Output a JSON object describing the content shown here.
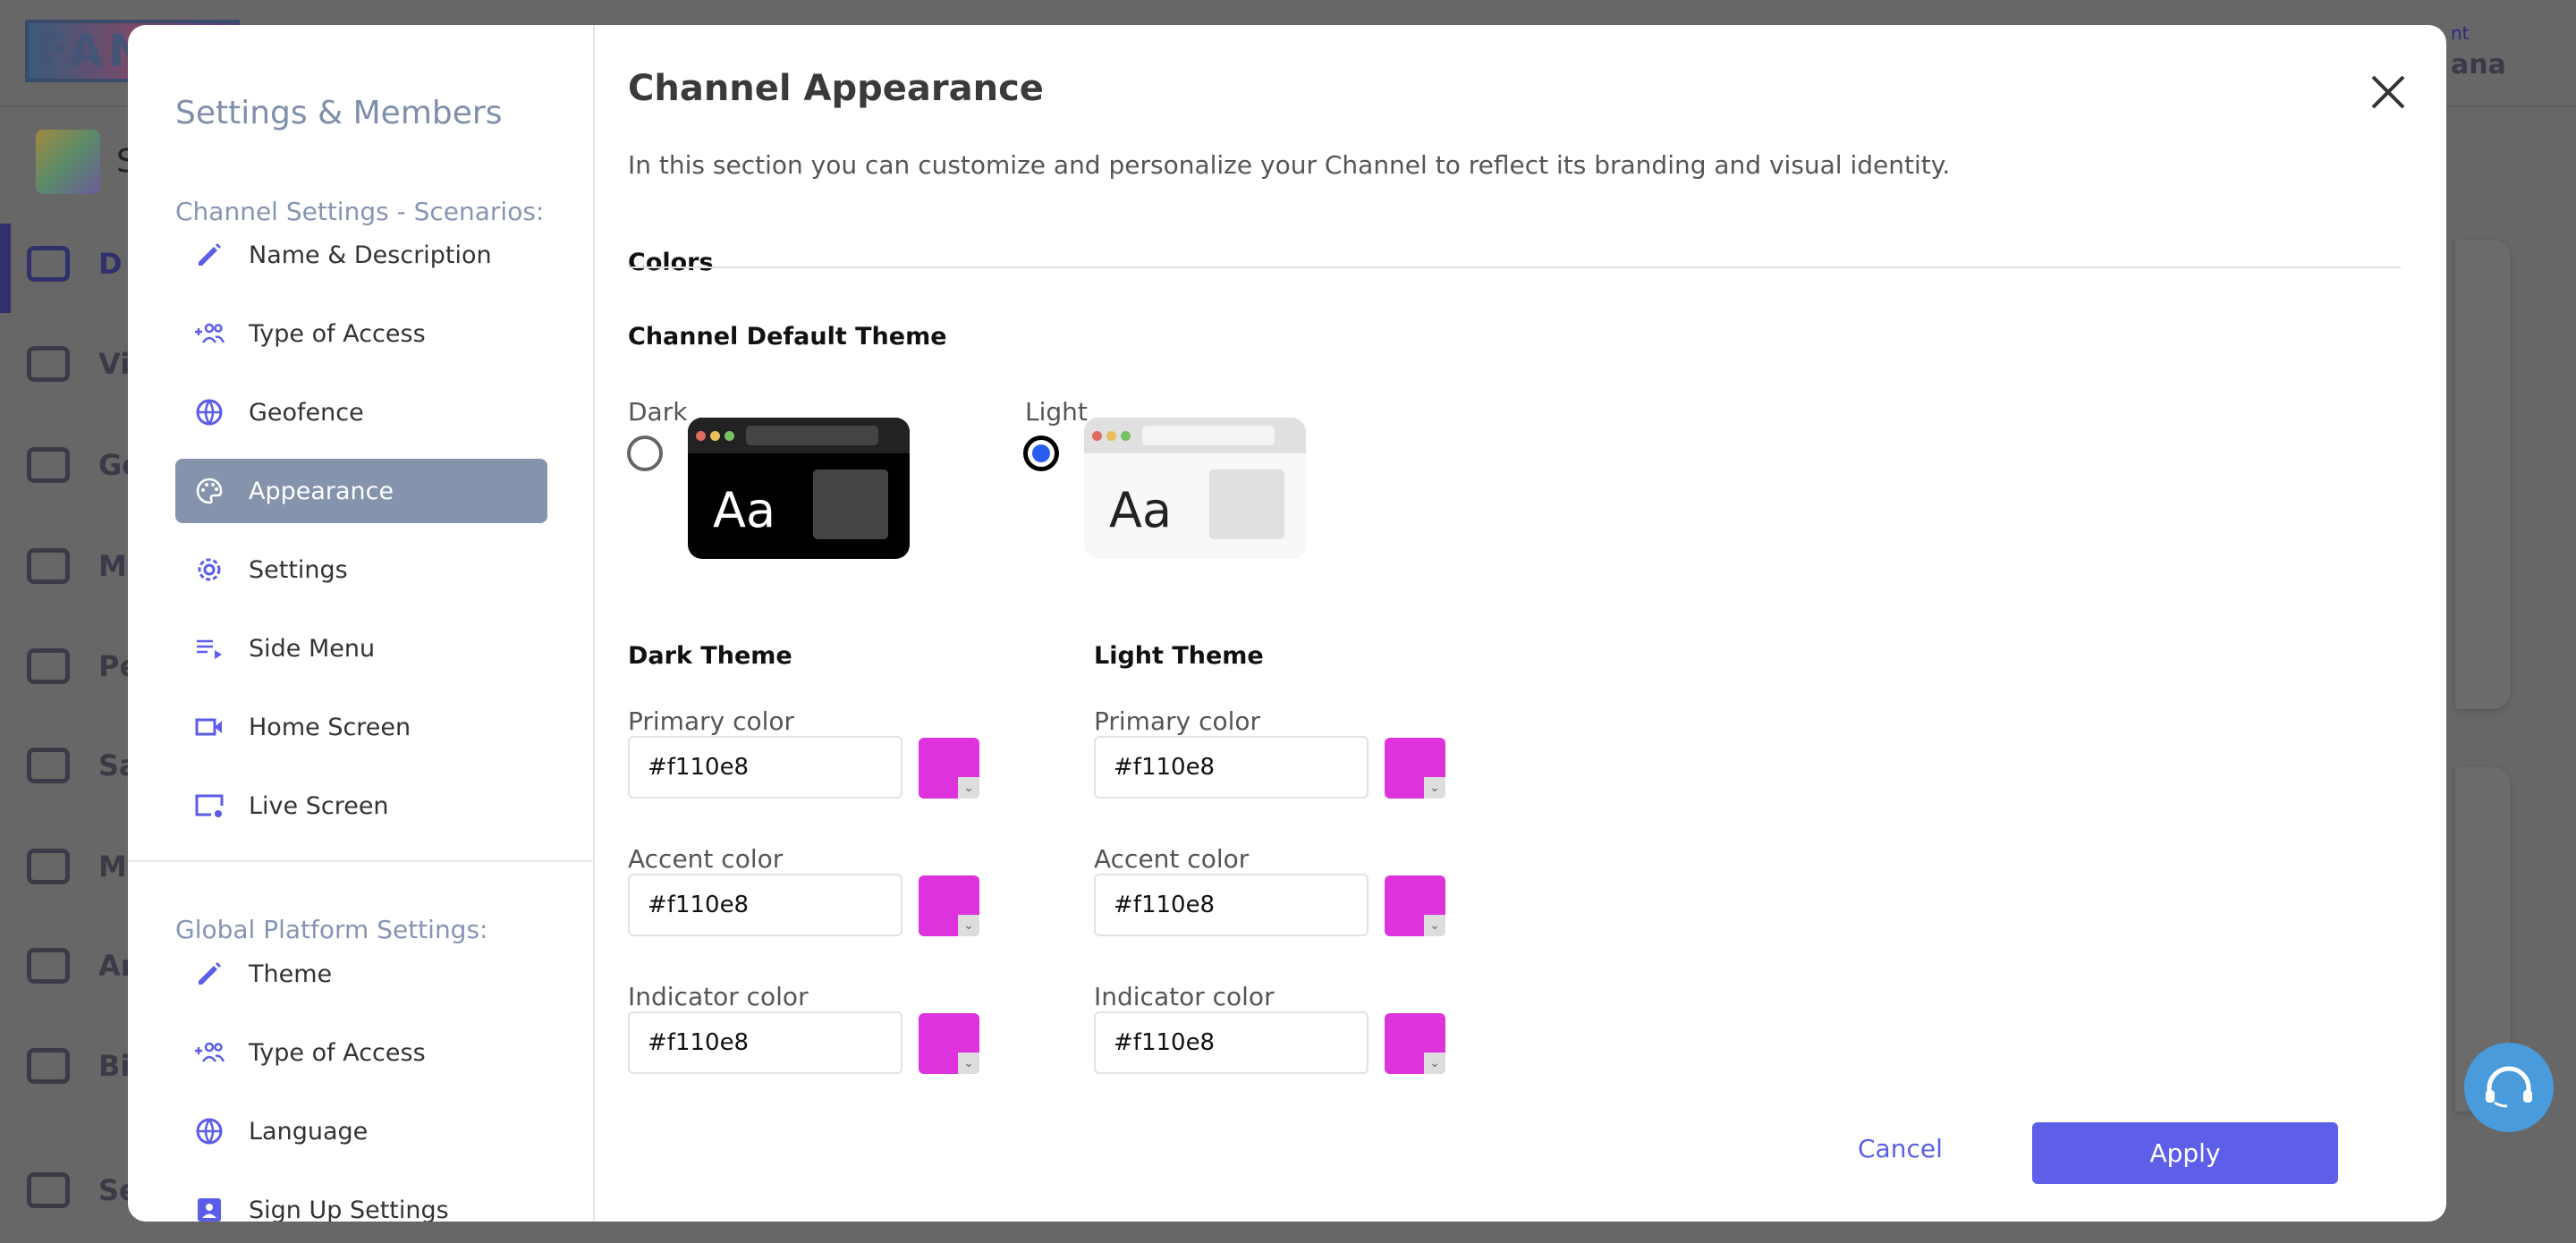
{
  "background": {
    "logo": "FANI",
    "channel_initial": "S",
    "user_line1": "nt",
    "user_line2": "ana",
    "sidebar": [
      "D",
      "Vi",
      "Go",
      "Ma",
      "Pe",
      "Sal",
      "Ma",
      "An",
      "Bil",
      "Se"
    ]
  },
  "sidebar": {
    "title": "Settings & Members",
    "channel_section": "Channel Settings - Scenarios:",
    "channel_items": [
      {
        "label": "Name & Description",
        "icon": "pencil-icon"
      },
      {
        "label": "Type of Access",
        "icon": "add-group-icon"
      },
      {
        "label": "Geofence",
        "icon": "globe-icon"
      },
      {
        "label": "Appearance",
        "icon": "palette-icon",
        "active": true
      },
      {
        "label": "Settings",
        "icon": "gear-icon"
      },
      {
        "label": "Side Menu",
        "icon": "playlist-icon"
      },
      {
        "label": "Home Screen",
        "icon": "video-camera-icon"
      },
      {
        "label": "Live Screen",
        "icon": "screen-settings-icon"
      }
    ],
    "global_section": "Global Platform Settings:",
    "global_items": [
      {
        "label": "Theme",
        "icon": "pencil-icon"
      },
      {
        "label": "Type of Access",
        "icon": "add-group-icon"
      },
      {
        "label": "Language",
        "icon": "globe-icon"
      },
      {
        "label": "Sign Up Settings",
        "icon": "user-card-icon"
      }
    ]
  },
  "main": {
    "title": "Channel Appearance",
    "subtitle": "In this section you can customize and personalize your Channel to reflect its branding and visual identity.",
    "colors_heading": "Colors",
    "default_theme_heading": "Channel Default Theme",
    "themes": [
      {
        "label": "Dark",
        "preview_text": "Aa",
        "selected": false
      },
      {
        "label": "Light",
        "preview_text": "Aa",
        "selected": true
      }
    ],
    "dark_theme": {
      "heading": "Dark Theme",
      "fields": [
        {
          "label": "Primary color",
          "value": "#f110e8"
        },
        {
          "label": "Accent color",
          "value": "#f110e8"
        },
        {
          "label": "Indicator color",
          "value": "#f110e8"
        }
      ]
    },
    "light_theme": {
      "heading": "Light Theme",
      "fields": [
        {
          "label": "Primary color",
          "value": "#f110e8"
        },
        {
          "label": "Accent color",
          "value": "#f110e8"
        },
        {
          "label": "Indicator color",
          "value": "#f110e8"
        }
      ]
    },
    "cancel_label": "Cancel",
    "apply_label": "Apply"
  },
  "colors": {
    "accent": "#5d5fe8",
    "active_nav": "#8593ad",
    "swatch": "#dd33dd",
    "radio_selected": "#2a5ef0"
  }
}
